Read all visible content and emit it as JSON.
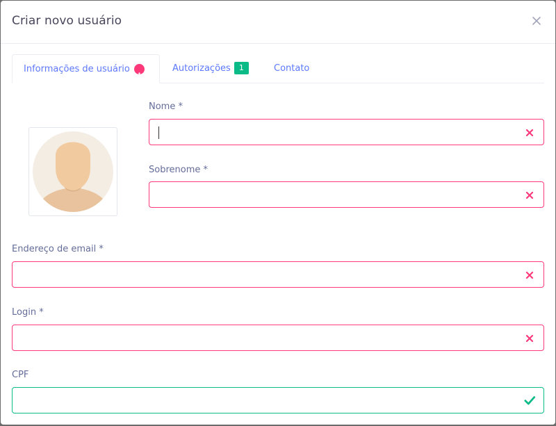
{
  "modal": {
    "title": "Criar novo usuário",
    "close_icon": "close-icon"
  },
  "tabs": [
    {
      "label": "Informações de usuário",
      "active": true,
      "indicator": "exclamation-circle-icon",
      "indicator_color": "#fd397a"
    },
    {
      "label": "Autorizações",
      "active": false,
      "badge": "1",
      "badge_color": "#0abb87"
    },
    {
      "label": "Contato",
      "active": false
    }
  ],
  "avatar": {
    "icon": "user-placeholder-avatar"
  },
  "fields": {
    "first_name": {
      "label": "Nome *",
      "value": "",
      "status": "invalid",
      "focused": true
    },
    "last_name": {
      "label": "Sobrenome *",
      "value": "",
      "status": "invalid"
    },
    "email": {
      "label": "Endereço de email *",
      "value": "",
      "status": "invalid"
    },
    "login": {
      "label": "Login *",
      "value": "",
      "status": "invalid"
    },
    "cpf": {
      "label": "CPF",
      "value": "",
      "status": "valid"
    }
  },
  "colors": {
    "accent": "#5d78ff",
    "error": "#fd397a",
    "success": "#0abb87",
    "label": "#646c9a",
    "title": "#48465b"
  }
}
